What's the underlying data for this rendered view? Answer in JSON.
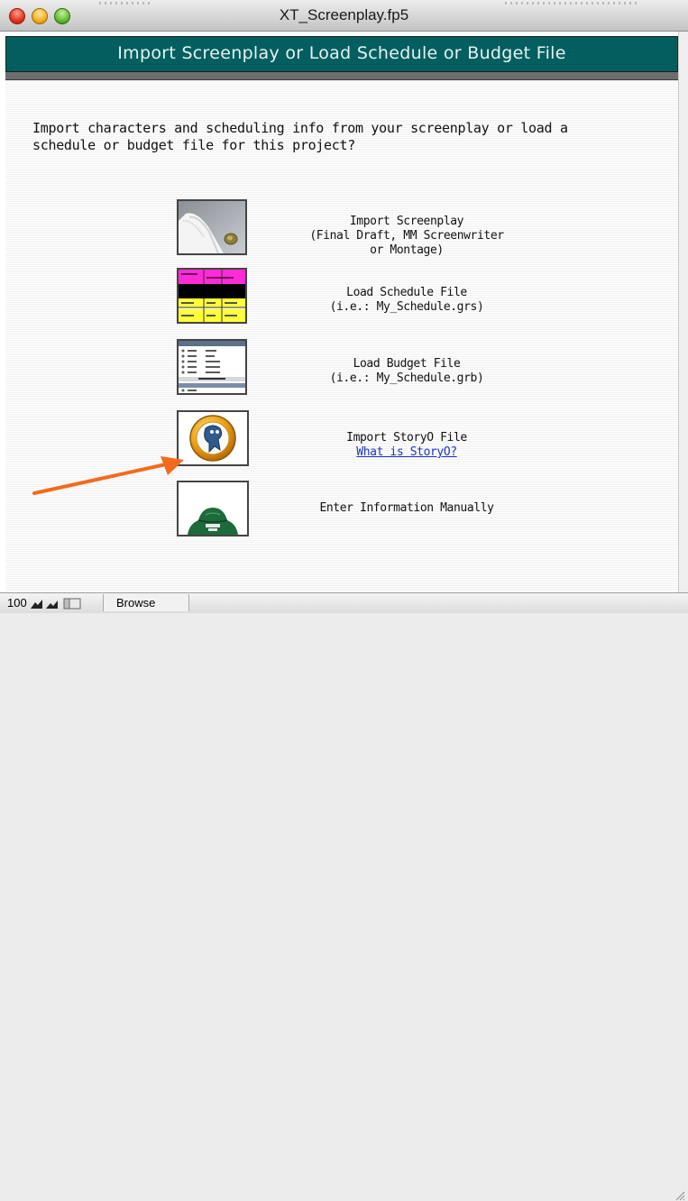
{
  "window": {
    "title": "XT_Screenplay.fp5",
    "traffic_colors": {
      "close": "#e0341f",
      "minimize": "#f2b01e",
      "zoom": "#5fbd2c"
    }
  },
  "header": {
    "title": "Import Screenplay or Load Schedule or Budget File",
    "band_color": "#035f5f"
  },
  "intro": {
    "line1": "Import characters and scheduling info from your screenplay or load a",
    "line2": "schedule or budget file for this project?"
  },
  "options": [
    {
      "icon": "screenplay-icon",
      "lines": [
        "Import Screenplay",
        "(Final Draft, MM Screenwriter",
        "or Montage)"
      ]
    },
    {
      "icon": "schedule-file-icon",
      "lines": [
        "Load Schedule File",
        "(i.e.: My_Schedule.grs)"
      ]
    },
    {
      "icon": "budget-file-icon",
      "lines": [
        "Load Budget File",
        "(i.e.: My_Schedule.grb)"
      ]
    },
    {
      "icon": "storyo-icon",
      "lines": [
        "Import StoryO File"
      ],
      "link": "What is StoryO?"
    },
    {
      "icon": "manual-entry-icon",
      "lines": [
        "Enter Information Manually"
      ]
    }
  ],
  "annotation": {
    "arrow_color": "#f26b1d",
    "points_to": "storyo-icon"
  },
  "statusbar": {
    "zoom": "100",
    "mode": "Browse"
  }
}
